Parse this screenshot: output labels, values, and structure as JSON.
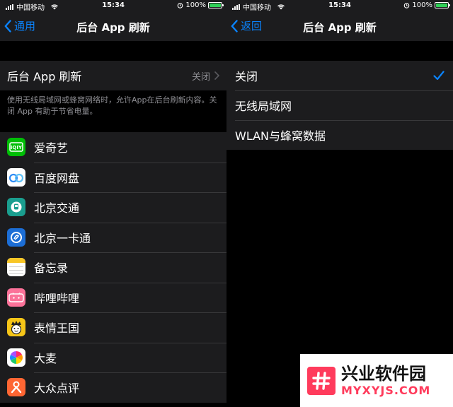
{
  "left": {
    "status": {
      "carrier": "中国移动",
      "time": "15:34",
      "battery": "100%"
    },
    "nav": {
      "back_label": "通用",
      "title": "后台 App 刷新"
    },
    "refresh_cell": {
      "label": "后台 App 刷新",
      "value": "关闭"
    },
    "footnote": "使用无线局域网或蜂窝网络时，允许App在后台刷新内容。关闭 App 有助于节省电量。",
    "apps": [
      {
        "name": "爱奇艺",
        "icon": "iqiyi-icon",
        "color": "#00be06"
      },
      {
        "name": "百度网盘",
        "icon": "baidu-netdisk-icon",
        "color": "#ffffff"
      },
      {
        "name": "北京交通",
        "icon": "beijing-transport-icon",
        "color": "#1a9e8f"
      },
      {
        "name": "北京一卡通",
        "icon": "beijing-card-icon",
        "color": "#1c6ed6"
      },
      {
        "name": "备忘录",
        "icon": "notes-icon",
        "color": "#ffffff"
      },
      {
        "name": "哔哩哔哩",
        "icon": "bilibili-icon",
        "color": "#fb7299"
      },
      {
        "name": "表情王国",
        "icon": "emoji-kingdom-icon",
        "color": "#f5c518"
      },
      {
        "name": "大麦",
        "icon": "damai-icon",
        "color": "#ffffff"
      },
      {
        "name": "大众点评",
        "icon": "dianping-icon",
        "color": "#ff6633"
      }
    ]
  },
  "right": {
    "status": {
      "carrier": "中国移动",
      "time": "15:34",
      "battery": "100%"
    },
    "nav": {
      "back_label": "返回",
      "title": "后台 App 刷新"
    },
    "options": [
      {
        "label": "关闭",
        "selected": true
      },
      {
        "label": "无线局域网",
        "selected": false
      },
      {
        "label": "WLAN与蜂窝数据",
        "selected": false
      }
    ]
  },
  "watermark": {
    "cn": "兴业软件园",
    "en": "MYXYJS.COM"
  },
  "colors": {
    "accent": "#0a84ff",
    "cell_bg": "#1c1c1e",
    "separator": "#38383a",
    "secondary_text": "#8e8e93",
    "battery": "#30d158"
  }
}
